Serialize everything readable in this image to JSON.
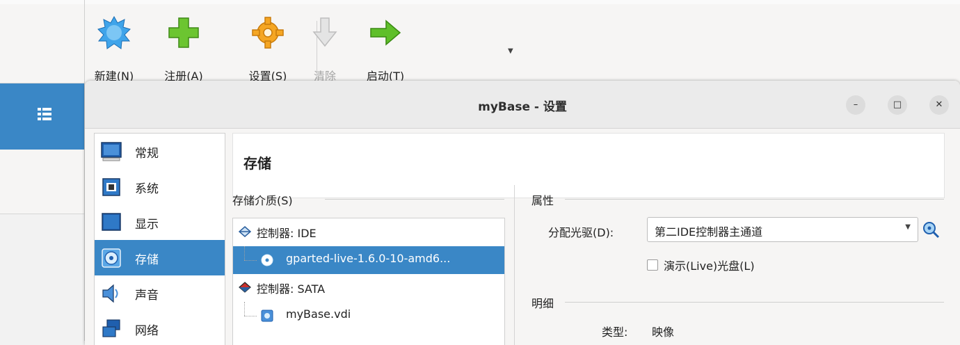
{
  "toolbar": {
    "new_label": "新建(N)",
    "register_label": "注册(A)",
    "settings_label": "设置(S)",
    "discard_label": "清除",
    "start_label": "启动(T)"
  },
  "dialog": {
    "title": "myBase - 设置",
    "window_buttons": {
      "minimize": "–",
      "maximize": "□",
      "close": "✕"
    },
    "categories": [
      {
        "label": "常规",
        "icon": "monitor-icon"
      },
      {
        "label": "系统",
        "icon": "chip-icon"
      },
      {
        "label": "显示",
        "icon": "display-icon"
      },
      {
        "label": "存储",
        "icon": "storage-disc-icon",
        "selected": true
      },
      {
        "label": "声音",
        "icon": "speaker-icon"
      },
      {
        "label": "网络",
        "icon": "network-icon"
      }
    ],
    "section_title": "存储",
    "storage_media_label": "存储介质(S)",
    "tree": [
      {
        "label": "控制器: IDE",
        "icon": "ide-controller-icon"
      },
      {
        "label": "gparted-live-1.6.0-10-amd6...",
        "icon": "optical-disc-icon",
        "selected": true
      },
      {
        "label": "控制器: SATA",
        "icon": "sata-controller-icon"
      },
      {
        "label": "myBase.vdi",
        "icon": "hard-disk-icon"
      }
    ],
    "attributes_label": "属性",
    "optical_drive_label": "分配光驱(D):",
    "optical_drive_value": "第二IDE控制器主通道",
    "live_cd_label": "演示(Live)光盘(L)",
    "details_label": "明细",
    "type_label": "类型:",
    "type_value": "映像"
  },
  "colors": {
    "selection": "#3a87c6",
    "accent_green": "#5fbf2a",
    "accent_orange": "#f2a21c"
  }
}
